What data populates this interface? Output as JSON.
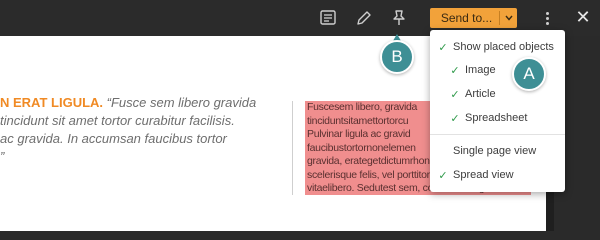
{
  "toolbar": {
    "send_label": "Send to...",
    "icons": [
      "notes-icon",
      "pencil-icon",
      "pin-icon",
      "chevron-down-icon",
      "more-vertical-icon",
      "close-icon"
    ],
    "close_glyph": "✕"
  },
  "colors": {
    "accent": "#f2a23a",
    "callout": "#3e8f95",
    "check": "#2f9a4a",
    "highlight": "#f08e8e",
    "heading_orange": "#f08a24"
  },
  "menu": {
    "items": [
      {
        "label": "Show placed objects",
        "checked": true
      },
      {
        "label": "Image",
        "checked": true
      },
      {
        "label": "Article",
        "checked": true
      },
      {
        "label": "Spreadsheet",
        "checked": true
      },
      {
        "label": "Single page view",
        "checked": false
      },
      {
        "label": "Spread view",
        "checked": true
      }
    ],
    "check_glyph": "✓"
  },
  "callouts": {
    "a": "A",
    "b": "B"
  },
  "document": {
    "heading_fragment": "N ERAT LIGULA.",
    "quote_lines": [
      "“Fusce sem libero gravida",
      "tincidunt sit amet tortor curabitur facilisis.",
      "ac gravida. In accumsan faucibus tortor",
      "”"
    ],
    "body_lines": [
      "Fuscesem libero, gravida",
      "tinciduntsitamettortorcu",
      "Pulvinar ligula ac gravid",
      "faucibustortornonelemen",
      "gravida, erategetdictumrhoncus, hendrerit nunc, nec tinc",
      "scelerisque felis, vel porttitor neque eros",
      "vitaelibero. Sedutest sem, convallis congue"
    ]
  }
}
